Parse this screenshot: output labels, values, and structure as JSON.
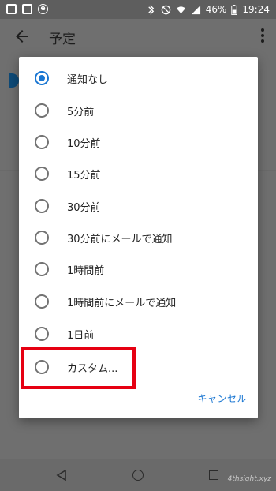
{
  "status_bar": {
    "battery_percent": "46%",
    "time": "19:24",
    "notification_icons": [
      "image-icon",
      "p-box-icon",
      "e-circle-icon"
    ],
    "system_icons": [
      "bluetooth-icon",
      "mute-icon",
      "wifi-icon",
      "signal-icon",
      "battery-icon"
    ]
  },
  "app_bar": {
    "title": "予定",
    "back_icon": "arrow-back-icon",
    "menu_icon": "more-vert-icon"
  },
  "dialog": {
    "options": [
      {
        "label": "通知なし",
        "selected": true
      },
      {
        "label": "5分前",
        "selected": false
      },
      {
        "label": "10分前",
        "selected": false
      },
      {
        "label": "15分前",
        "selected": false
      },
      {
        "label": "30分前",
        "selected": false
      },
      {
        "label": "30分前にメールで通知",
        "selected": false
      },
      {
        "label": "1時間前",
        "selected": false
      },
      {
        "label": "1時間前にメールで通知",
        "selected": false
      },
      {
        "label": "1日前",
        "selected": false
      },
      {
        "label": "カスタム...",
        "selected": false
      }
    ],
    "cancel_label": "キャンセル"
  },
  "watermark": "4thsight.xyz",
  "colors": {
    "accent": "#1976d2",
    "highlight": "#e60012"
  }
}
